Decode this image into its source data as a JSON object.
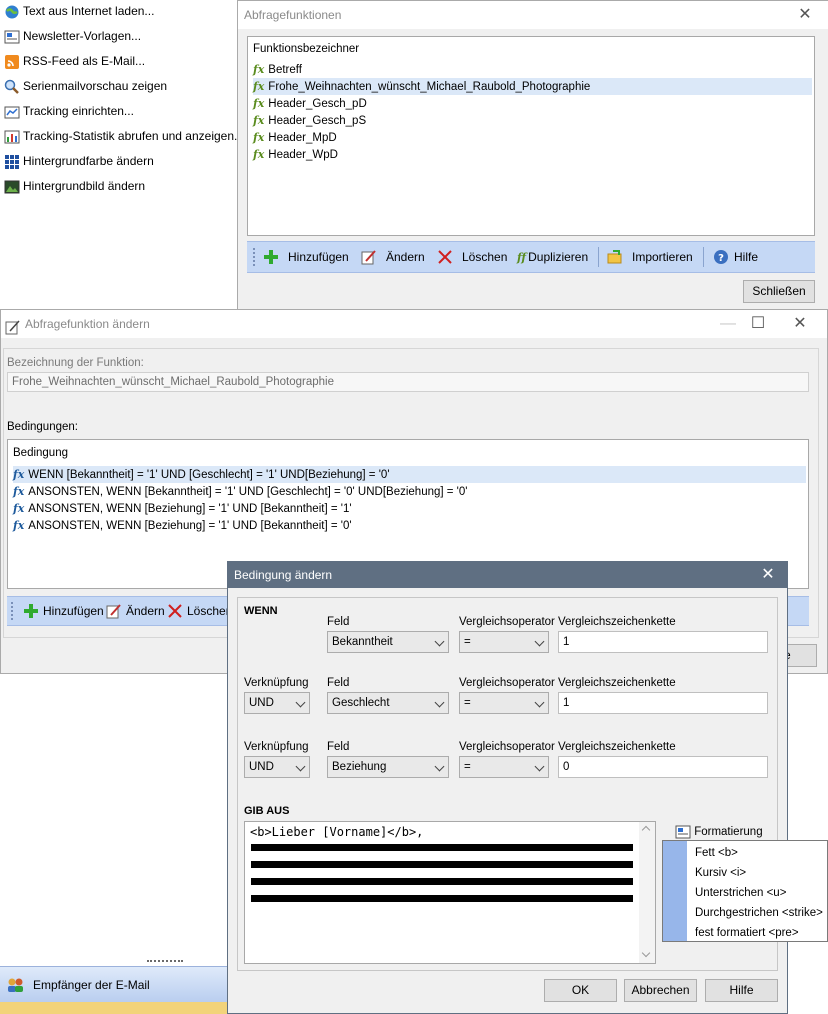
{
  "sidebar": {
    "items": [
      {
        "label": "Text aus Internet laden...",
        "icon": "globe-icon"
      },
      {
        "label": "Newsletter-Vorlagen...",
        "icon": "newsletter-icon"
      },
      {
        "label": "RSS-Feed als E-Mail...",
        "icon": "rss-icon"
      },
      {
        "label": "Serienmailvorschau zeigen",
        "icon": "preview-icon"
      },
      {
        "label": "Tracking einrichten...",
        "icon": "tracking-icon"
      },
      {
        "label": "Tracking-Statistik abrufen und anzeigen...",
        "icon": "chart-icon"
      },
      {
        "label": "Hintergrundfarbe ändern",
        "icon": "color-grid-icon"
      },
      {
        "label": "Hintergrundbild ändern",
        "icon": "image-icon"
      }
    ],
    "bottom_label": "Empfänger der E-Mail"
  },
  "abfrage": {
    "title": "Abfragefunktionen",
    "list_header": "Funktionsbezeichner",
    "items": [
      "Betreff",
      "Frohe_Weihnachten_wünscht_Michael_Raubold_Photographie",
      "Header_Gesch_pD",
      "Header_Gesch_pS",
      "Header_MpD",
      "Header_WpD"
    ],
    "toolbar": {
      "add": "Hinzufügen",
      "edit": "Ändern",
      "delete": "Löschen",
      "duplicate": "Duplizieren",
      "import": "Importieren",
      "help": "Hilfe"
    },
    "close_button": "Schließen"
  },
  "aendern": {
    "title": "Abfragefunktion ändern",
    "name_label": "Bezeichnung der Funktion:",
    "name_value": "Frohe_Weihnachten_wünscht_Michael_Raubold_Photographie",
    "conditions_label": "Bedingungen:",
    "list_header": "Bedingung",
    "conditions": [
      "WENN [Bekanntheit] = '1' UND [Geschlecht] = '1' UND[Beziehung] = '0'",
      "ANSONSTEN, WENN [Bekanntheit] = '1' UND [Geschlecht] = '0' UND[Beziehung] = '0'",
      "ANSONSTEN, WENN [Beziehung] = '1' UND [Bekanntheit] = '1'",
      "ANSONSTEN, WENN [Beziehung] = '1' UND [Bekanntheit] = '0'"
    ],
    "toolbar": {
      "add": "Hinzufügen",
      "edit": "Ändern",
      "delete": "Löschen"
    },
    "partial_button": "e"
  },
  "bedingung": {
    "title": "Bedingung ändern",
    "wenn": "WENN",
    "feld": "Feld",
    "operator": "Vergleichsoperator",
    "kette": "Vergleichszeichenkette",
    "verknuepfung": "Verknüpfung",
    "rows": [
      {
        "feld": "Bekanntheit",
        "op": "=",
        "value": "1"
      },
      {
        "link": "UND",
        "feld": "Geschlecht",
        "op": "=",
        "value": "1"
      },
      {
        "link": "UND",
        "feld": "Beziehung",
        "op": "=",
        "value": "0"
      }
    ],
    "gib_aus": "GIB AUS",
    "output_first_line": "<b>Lieber [Vorname]</b>,",
    "format_button": "Formatierung",
    "format_menu": [
      "Fett <b>",
      "Kursiv <i>",
      "Unterstrichen <u>",
      "Durchgestrichen <strike>",
      "fest formatiert <pre>"
    ],
    "ok": "OK",
    "cancel": "Abbrechen",
    "help": "Hilfe"
  },
  "colors": {
    "toolbar": "#c5d8f5",
    "selection": "#dbe8f8",
    "titlebar_dark": "#5f6f82",
    "menu_strip": "#97b6ea"
  }
}
